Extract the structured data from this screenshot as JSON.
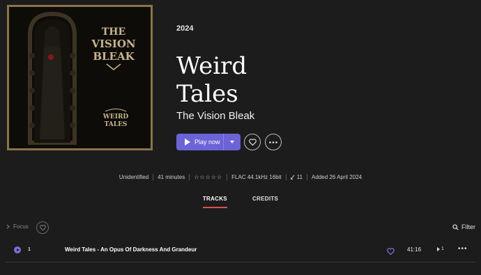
{
  "album": {
    "year": "2024",
    "title": "Weird Tales",
    "artist": "The Vision Bleak",
    "cover_text_band": "THE VISION BLEAK",
    "cover_text_album": "WEIRD TALES"
  },
  "actions": {
    "play_label": "Play now",
    "accent_color": "#6d63d8"
  },
  "meta": {
    "status": "Unidentified",
    "duration": "41 minutes",
    "rating_stars": "☆☆☆☆☆",
    "format": "FLAC 44.1kHz 16bit",
    "track_count": "11",
    "added": "Added 26 April 2024"
  },
  "tabs": [
    {
      "label": "TRACKS",
      "active": true
    },
    {
      "label": "CREDITS",
      "active": false
    }
  ],
  "toolbar": {
    "focus_label": "Focus",
    "filter_label": "Filter"
  },
  "tracks": [
    {
      "number": "1",
      "title": "Weird Tales - An Opus Of Darkness And Grandeur",
      "duration": "41:16",
      "next_count": "1"
    }
  ]
}
